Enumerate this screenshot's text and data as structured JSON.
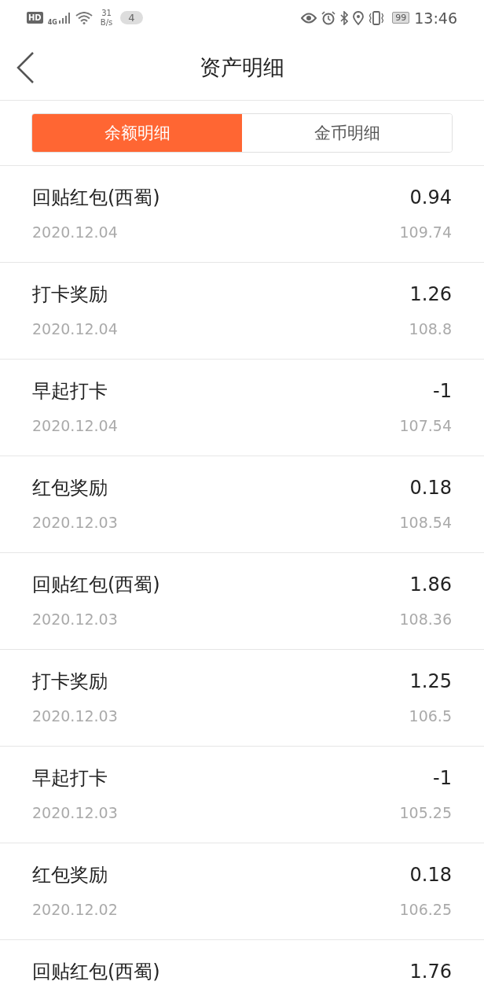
{
  "status_bar": {
    "hd": "HD",
    "network": "4G",
    "speed_value": "31",
    "speed_unit": "B/s",
    "notification_count": "4",
    "battery": "99",
    "time": "13:46"
  },
  "header": {
    "title": "资产明细"
  },
  "tabs": [
    {
      "label": "余额明细",
      "selected": true
    },
    {
      "label": "金币明细",
      "selected": false
    }
  ],
  "records": [
    {
      "title": "回贴红包(西蜀)",
      "amount": "0.94",
      "date": "2020.12.04",
      "balance": "109.74"
    },
    {
      "title": "打卡奖励",
      "amount": "1.26",
      "date": "2020.12.04",
      "balance": "108.8"
    },
    {
      "title": "早起打卡",
      "amount": "-1",
      "date": "2020.12.04",
      "balance": "107.54"
    },
    {
      "title": "红包奖励",
      "amount": "0.18",
      "date": "2020.12.03",
      "balance": "108.54"
    },
    {
      "title": "回贴红包(西蜀)",
      "amount": "1.86",
      "date": "2020.12.03",
      "balance": "108.36"
    },
    {
      "title": "打卡奖励",
      "amount": "1.25",
      "date": "2020.12.03",
      "balance": "106.5"
    },
    {
      "title": "早起打卡",
      "amount": "-1",
      "date": "2020.12.03",
      "balance": "105.25"
    },
    {
      "title": "红包奖励",
      "amount": "0.18",
      "date": "2020.12.02",
      "balance": "106.25"
    },
    {
      "title": "回贴红包(西蜀)",
      "amount": "1.76"
    }
  ]
}
